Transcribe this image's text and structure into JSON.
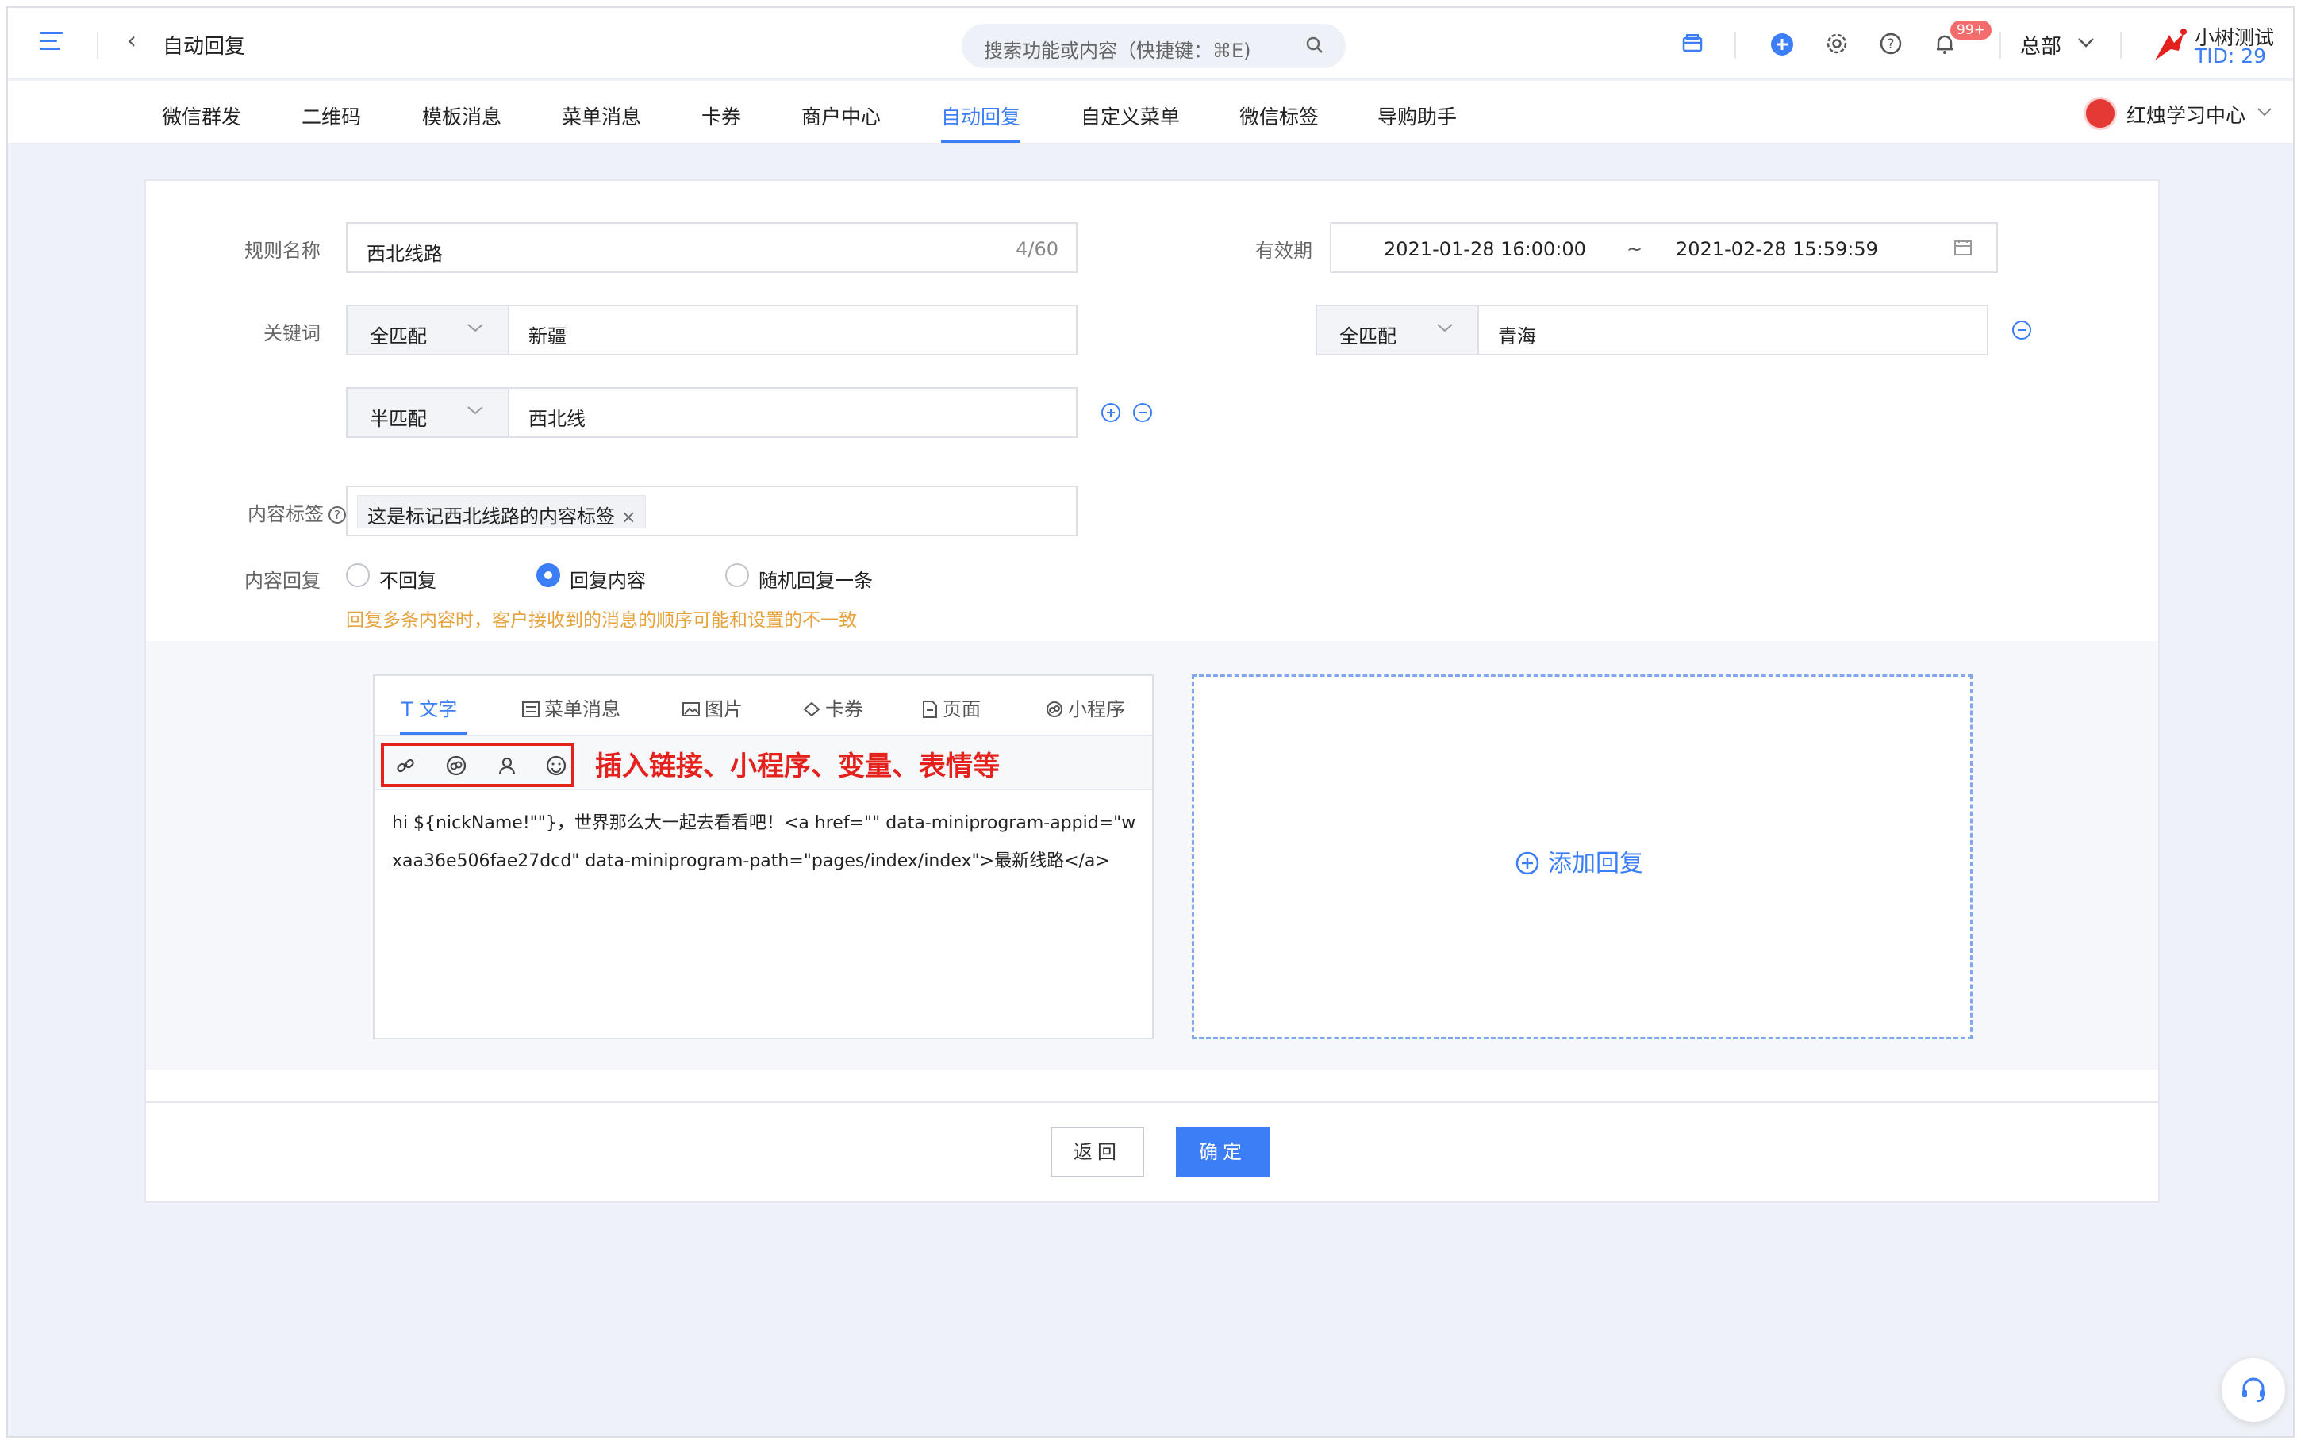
{
  "header": {
    "title": "自动回复",
    "search_placeholder": "搜索功能或内容（快捷键：⌘E)",
    "notification_badge": "99+",
    "org": "总部",
    "user_name": "小树测试",
    "tid": "TID: 29"
  },
  "nav": {
    "items": [
      "微信群发",
      "二维码",
      "模板消息",
      "菜单消息",
      "卡券",
      "商户中心",
      "自动回复",
      "自定义菜单",
      "微信标签",
      "导购助手"
    ],
    "active_index": 6,
    "store": "红烛学习中心"
  },
  "form": {
    "rule_name_label": "规则名称",
    "rule_name_value": "西北线路",
    "rule_name_count": "4/60",
    "validity_label": "有效期",
    "date_start": "2021-01-28 16:00:00",
    "date_sep": "~",
    "date_end": "2021-02-28 15:59:59",
    "keyword_label": "关键词",
    "keywords": [
      {
        "match": "全匹配",
        "value": "新疆"
      },
      {
        "match": "全匹配",
        "value": "青海"
      },
      {
        "match": "半匹配",
        "value": "西北线"
      }
    ],
    "content_tag_label": "内容标签",
    "content_tag_value": "这是标记西北线路的内容标签",
    "tag_remove": "×",
    "content_reply_label": "内容回复",
    "reply_options": [
      "不回复",
      "回复内容",
      "随机回复一条"
    ],
    "reply_selected_index": 1,
    "warning": "回复多条内容时，客户接收到的消息的顺序可能和设置的不一致"
  },
  "editor": {
    "tabs": [
      "文字",
      "菜单消息",
      "图片",
      "卡券",
      "页面",
      "小程序"
    ],
    "active_tab_index": 0,
    "annotation": "插入链接、小程序、变量、表情等",
    "content": "hi ${nickName!\"\"}，世界那么大一起去看看吧！<a href=\"\" data-miniprogram-appid=\"wxaa36e506fae27dcd\" data-miniprogram-path=\"pages/index/index\">最新线路</a>",
    "add_reply": "添加回复"
  },
  "footer": {
    "back_label": "返回",
    "confirm_label": "确定"
  },
  "colors": {
    "primary": "#3b7ef6",
    "warning": "#e6a23c",
    "annotation_red": "#e5211d"
  }
}
